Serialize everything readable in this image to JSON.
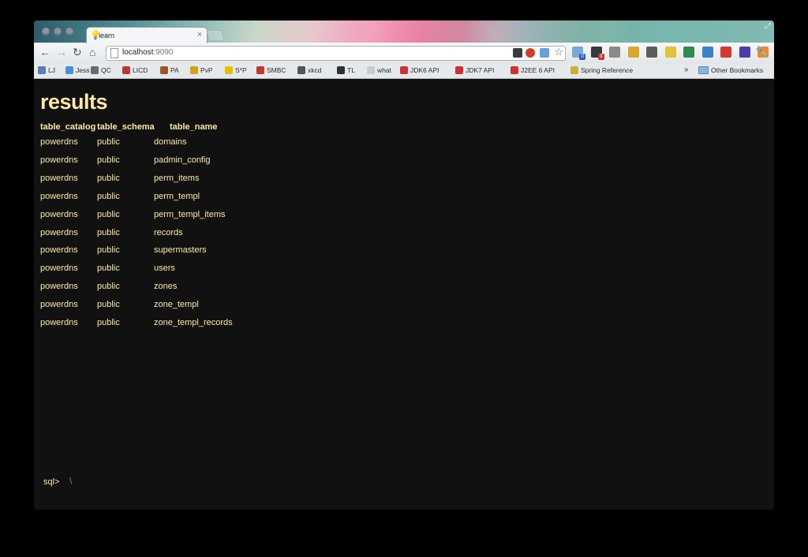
{
  "tab": {
    "title": "learn"
  },
  "address": {
    "host": "localhost",
    "port": ":9090"
  },
  "bookmarks": [
    {
      "label": "LJ",
      "color": "#5b7db6"
    },
    {
      "label": "Jess",
      "color": "#4d90d6"
    },
    {
      "label": "QC",
      "color": "#6b6b6b"
    },
    {
      "label": "LICD",
      "color": "#b23a3a"
    },
    {
      "label": "PA",
      "color": "#a0522d"
    },
    {
      "label": "PvP",
      "color": "#d4a017"
    },
    {
      "label": "S*P",
      "color": "#e2c300"
    },
    {
      "label": "SMBC",
      "color": "#c0392b"
    },
    {
      "label": "xkcd",
      "color": "#555555"
    },
    {
      "label": "TL",
      "color": "#2f2f2f"
    },
    {
      "label": "what",
      "color": "#cccccc"
    },
    {
      "label": "JDK6 API",
      "color": "#d0312d"
    },
    {
      "label": "JDK7 API",
      "color": "#d0312d"
    },
    {
      "label": "J2EE 6 API",
      "color": "#d0312d"
    },
    {
      "label": "Spring Reference",
      "color": "#c9b037"
    }
  ],
  "other_bookmarks": "Other Bookmarks",
  "extensions": [
    {
      "name": "stackexchange-icon",
      "badge": "0",
      "badge_color": "#2a5db0",
      "color": "#7aa7d8"
    },
    {
      "name": "stackoverflow-icon",
      "badge": "3",
      "badge_color": "#c0392b",
      "color": "#3a3a3a"
    },
    {
      "name": "tool-icon",
      "badge": "",
      "color": "#8a8a8a"
    },
    {
      "name": "bus-icon",
      "badge": "",
      "color": "#d8a82a"
    },
    {
      "name": "evernote-icon",
      "badge": "",
      "color": "#5d5d5d"
    },
    {
      "name": "tag-icon",
      "badge": "",
      "color": "#e0c43a"
    },
    {
      "name": "phone-icon",
      "badge": "",
      "color": "#2f8a4f"
    },
    {
      "name": "mail-icon",
      "badge": "",
      "color": "#3a82d0"
    },
    {
      "name": "opera-icon",
      "badge": "",
      "color": "#d63a2e"
    },
    {
      "name": "spy-icon",
      "badge": "",
      "color": "#4a3fa8"
    },
    {
      "name": "rss-icon",
      "badge": "",
      "color": "#f08a24"
    }
  ],
  "main": {
    "heading": "results",
    "columns": [
      "table_catalog",
      "table_schema",
      "table_name"
    ],
    "rows": [
      [
        "powerdns",
        "public",
        "domains"
      ],
      [
        "powerdns",
        "public",
        "padmin_config"
      ],
      [
        "powerdns",
        "public",
        "perm_items"
      ],
      [
        "powerdns",
        "public",
        "perm_templ"
      ],
      [
        "powerdns",
        "public",
        "perm_templ_items"
      ],
      [
        "powerdns",
        "public",
        "records"
      ],
      [
        "powerdns",
        "public",
        "supermasters"
      ],
      [
        "powerdns",
        "public",
        "users"
      ],
      [
        "powerdns",
        "public",
        "zones"
      ],
      [
        "powerdns",
        "public",
        "zone_templ"
      ],
      [
        "powerdns",
        "public",
        "zone_templ_records"
      ]
    ],
    "prompt": "sql>",
    "input_value": "\\"
  }
}
